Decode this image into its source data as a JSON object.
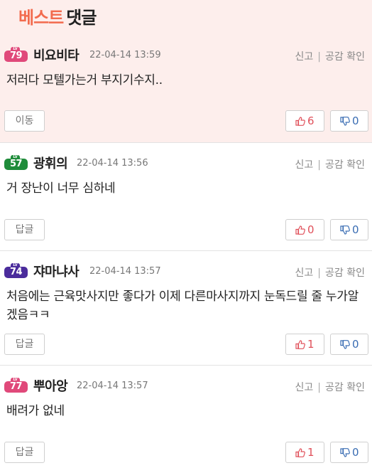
{
  "header": {
    "best": "베스트",
    "comments": "댓글"
  },
  "actions": {
    "report": "신고",
    "sep": "|",
    "empathy": "공감 확인"
  },
  "comments": [
    {
      "level": "79",
      "level_color": "pink",
      "nickname": "비요비타",
      "date": "22-04-14 13:59",
      "text": "저러다 모텔가는거 부지기수지..",
      "button": "이동",
      "likes": "6",
      "dislikes": "0"
    },
    {
      "level": "57",
      "level_color": "green",
      "nickname": "광휘의",
      "date": "22-04-14 13:56",
      "text": "거 장난이 너무 심하네",
      "button": "답글",
      "likes": "0",
      "dislikes": "0"
    },
    {
      "level": "74",
      "level_color": "purple",
      "nickname": "쟈마냐사",
      "date": "22-04-14 13:57",
      "text": "처음에는 근육맛사지만 좋다가 이제 다른마사지까지 눈독드릴 줄 누가알겠음ㅋㅋ",
      "button": "답글",
      "likes": "1",
      "dislikes": "0"
    },
    {
      "level": "77",
      "level_color": "pink",
      "nickname": "뿌아앙",
      "date": "22-04-14 13:57",
      "text": "배려가 없네",
      "button": "답글",
      "likes": "1",
      "dislikes": "0"
    }
  ],
  "level_badge_cap": "LV",
  "icons": {
    "up": "thumbs-up-icon",
    "down": "thumbs-down-icon"
  },
  "colors": {
    "accent": "#f26b4e",
    "like": "#e0505a",
    "dislike": "#3a6db3",
    "best_bg": "#fdeeec"
  }
}
